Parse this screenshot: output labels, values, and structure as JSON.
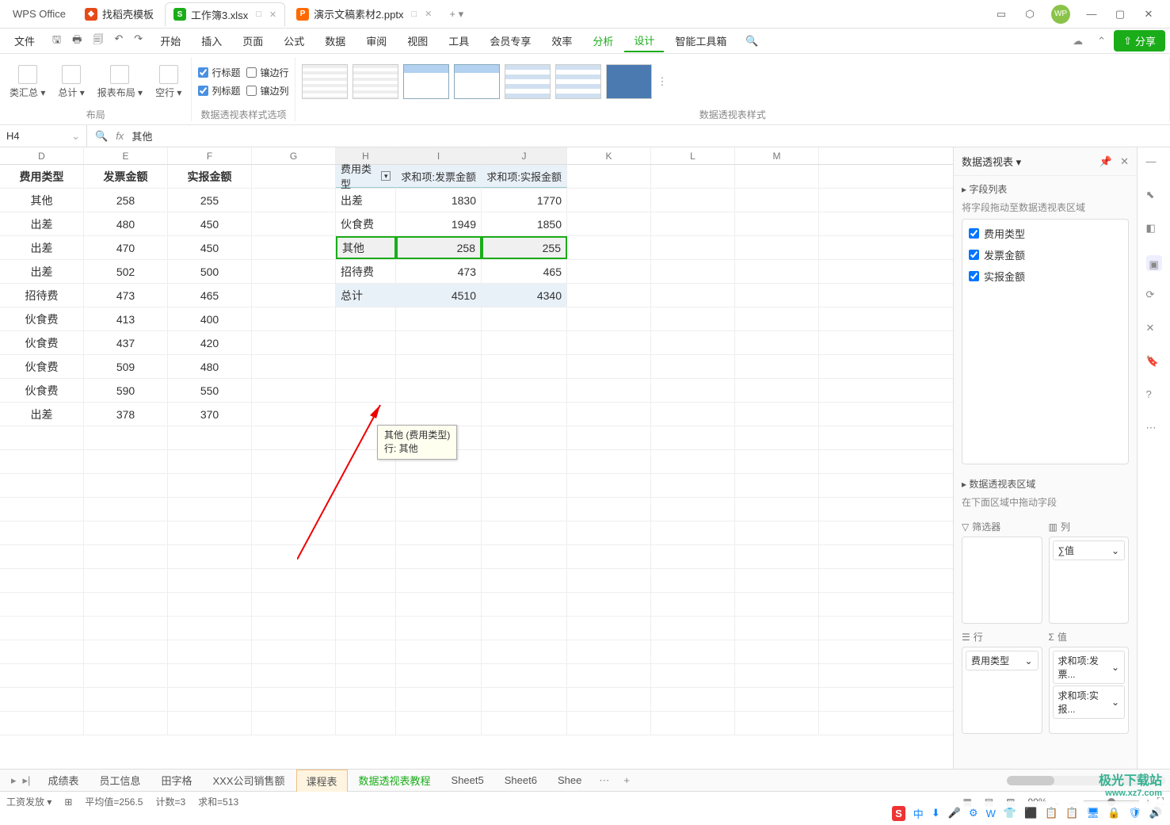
{
  "app": {
    "name": "WPS Office"
  },
  "tabs": [
    {
      "icon": "orange",
      "iconText": "",
      "label": "找稻壳模板"
    },
    {
      "icon": "green",
      "iconText": "S",
      "label": "工作簿3.xlsx",
      "active": true,
      "dim": "□"
    },
    {
      "icon": "red",
      "iconText": "P",
      "label": "演示文稿素材2.pptx",
      "dim": "□"
    }
  ],
  "menus": {
    "file": "文件",
    "items": [
      "开始",
      "插入",
      "页面",
      "公式",
      "数据",
      "审阅",
      "视图",
      "工具",
      "会员专享",
      "效率",
      "分析",
      "设计",
      "智能工具箱"
    ],
    "active": "设计",
    "analyze": "分析",
    "share": "分享"
  },
  "ribbon": {
    "group_layout": "布局",
    "btns": {
      "subtotal": "类汇总 ▾",
      "grandtotal": "总计 ▾",
      "report": "报表布局 ▾",
      "blank": "空行 ▾"
    },
    "group_options": "数据透视表样式选项",
    "checks": {
      "rowhdr": "行标题",
      "colhdr": "列标题",
      "rowband": "镶边行",
      "colband": "镶边列"
    },
    "group_styles": "数据透视表样式"
  },
  "formula": {
    "cellref": "H4",
    "fx": "fx",
    "value": "其他"
  },
  "columns": [
    "D",
    "E",
    "F",
    "G",
    "H",
    "I",
    "J",
    "K",
    "L",
    "M"
  ],
  "left_table": {
    "headers": {
      "D": "费用类型",
      "E": "发票金额",
      "F": "实报金额"
    },
    "rows": [
      [
        "其他",
        "258",
        "255"
      ],
      [
        "出差",
        "480",
        "450"
      ],
      [
        "出差",
        "470",
        "450"
      ],
      [
        "出差",
        "502",
        "500"
      ],
      [
        "招待费",
        "473",
        "465"
      ],
      [
        "伙食费",
        "413",
        "400"
      ],
      [
        "伙食费",
        "437",
        "420"
      ],
      [
        "伙食费",
        "509",
        "480"
      ],
      [
        "伙食费",
        "590",
        "550"
      ],
      [
        "出差",
        "378",
        "370"
      ]
    ]
  },
  "pivot": {
    "headers": {
      "H": "费用类型",
      "I": "求和项:发票金额",
      "J": "求和项:实报金额"
    },
    "rows": [
      [
        "出差",
        "1830",
        "1770"
      ],
      [
        "伙食费",
        "1949",
        "1850"
      ],
      [
        "其他",
        "258",
        "255"
      ],
      [
        "招待费",
        "473",
        "465"
      ],
      [
        "总计",
        "4510",
        "4340"
      ]
    ],
    "selected_row": 2
  },
  "tooltip": {
    "line1": "其他 (费用类型)",
    "line2": "行: 其他"
  },
  "side": {
    "title": "数据透视表 ▾",
    "fieldlist_title": "字段列表",
    "fieldlist_hint": "将字段拖动至数据透视表区域",
    "fields": [
      "费用类型",
      "发票金额",
      "实报金额"
    ],
    "areas_title": "数据透视表区域",
    "areas_hint": "在下面区域中拖动字段",
    "filter": "筛选器",
    "cols": "列",
    "rows": "行",
    "vals": "值",
    "col_item": "∑值",
    "row_item": "费用类型",
    "val_items": [
      "求和项:发票...",
      "求和项:实报..."
    ]
  },
  "sheet_tabs": {
    "items": [
      "成绩表",
      "员工信息",
      "田字格",
      "XXX公司销售额",
      "课程表",
      "数据透视表教程",
      "Sheet5",
      "Sheet6",
      "Shee"
    ],
    "active": "课程表",
    "green": "数据透视表教程"
  },
  "status": {
    "left": "工资发放 ▾",
    "avg": "平均值=256.5",
    "count": "计数=3",
    "sum": "求和=513",
    "zoom": "90%"
  },
  "watermark": {
    "line1": "极光下载站",
    "line2": "www.xz7.com"
  },
  "tray_icons": [
    "中",
    "⬇",
    "🎤",
    "⚙",
    "W",
    "👕",
    "⬛",
    "📋",
    "📋",
    "🖥",
    "🔒",
    "🛡",
    "🔊"
  ]
}
